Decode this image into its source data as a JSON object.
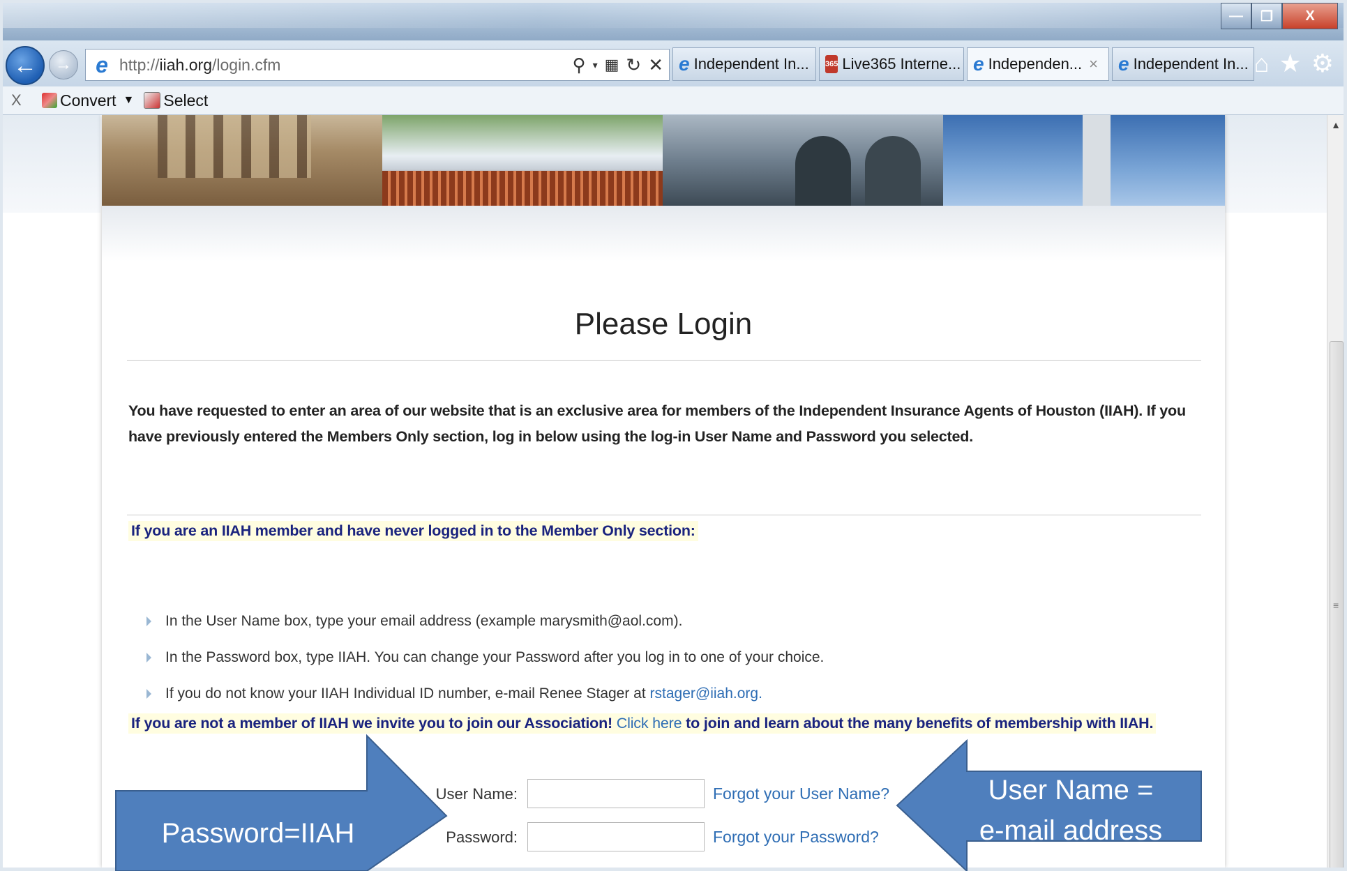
{
  "browser": {
    "window_controls": {
      "minimize": "—",
      "maximize": "❐",
      "close": "X"
    },
    "address": {
      "url_prefix": "http://",
      "url_host": "iiah.org",
      "url_path": "/login.cfm"
    },
    "tabs": [
      {
        "label": "Independent In...",
        "icon": "ie-icon",
        "active": false
      },
      {
        "label": "Live365 Interne...",
        "icon": "live365-icon",
        "active": false
      },
      {
        "label": "Independen...",
        "icon": "ie-icon",
        "active": true,
        "close": "×"
      },
      {
        "label": "Independent In...",
        "icon": "ie-icon",
        "active": false
      }
    ],
    "command_bar": {
      "close": "X",
      "convert": "Convert",
      "select": "Select"
    }
  },
  "page": {
    "title": "Please Login",
    "intro": "You have requested to enter an area of our website that is an exclusive area for members of the Independent Insurance Agents of Houston (IIAH). If you have previously entered the Members Only section, log in below using the log-in User Name and Password you selected.",
    "member_heading": "If you are an IIAH member and have never logged in to the Member Only section:",
    "bullets": [
      "In the User Name box, type your email address (example marysmith@aol.com).",
      "In the Password box, type IIAH. You can change your Password after you log in to one of your choice.",
      "If you do not know your IIAH Individual ID number, e-mail Renee Stager at"
    ],
    "contact_email": "rstager@iiah.org",
    "bullet3_suffix": " .",
    "join": {
      "prefix": "If you are not a member of IIAH we invite you to join our Association! ",
      "link": "Click here",
      "suffix": " to join and learn about the many benefits of membership with IIAH."
    },
    "form": {
      "username_label": "User Name:",
      "password_label": "Password:",
      "forgot_username": "Forgot your User Name?",
      "forgot_password": "Forgot your Password?"
    }
  },
  "annotations": {
    "left_callout": "Password=IIAH",
    "right_callout_line1": "User Name =",
    "right_callout_line2": "e-mail address",
    "arrow_color": "#4f7fbd"
  }
}
